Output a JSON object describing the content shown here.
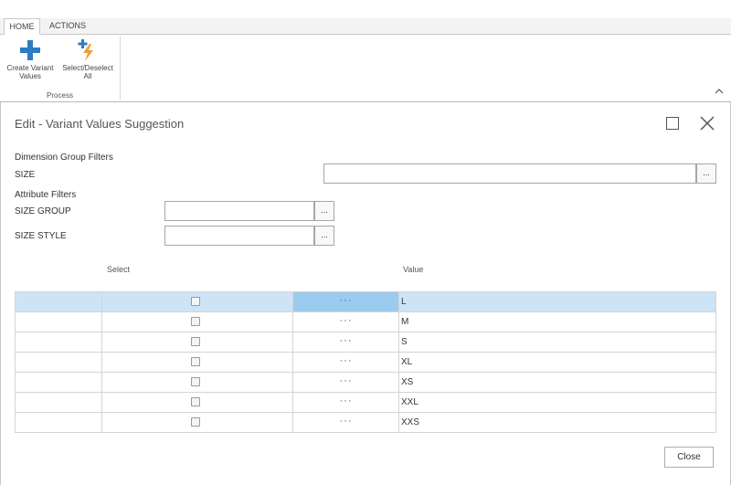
{
  "ribbon": {
    "tabs": [
      "HOME",
      "ACTIONS"
    ],
    "buttons": [
      {
        "label": "Create Variant Values",
        "icon": "plus-icon"
      },
      {
        "label": "Select/Deselect All",
        "icon": "select-deselect-icon"
      }
    ],
    "group_label": "Process"
  },
  "dialog": {
    "title": "Edit - Variant Values Suggestion",
    "dimension_section": "Dimension Group Filters",
    "size_label": "SIZE",
    "size_value": "",
    "attribute_section": "Attribute Filters",
    "size_group_label": "SIZE GROUP",
    "size_group_value": "",
    "size_style_label": "SIZE STYLE",
    "size_style_value": "",
    "lookup_label": "...",
    "columns": {
      "select": "Select",
      "value": "Value"
    },
    "rows": [
      {
        "value": "L",
        "checked": false,
        "selected": true
      },
      {
        "value": "M",
        "checked": false
      },
      {
        "value": "S",
        "checked": false
      },
      {
        "value": "XL",
        "checked": false
      },
      {
        "value": "XS",
        "checked": false
      },
      {
        "value": "XXL",
        "checked": false
      },
      {
        "value": "XXS",
        "checked": false
      }
    ],
    "row_menu": "···",
    "close_label": "Close"
  },
  "colors": {
    "selected_row": "#cde4f7",
    "selected_cell": "#9bcbee",
    "icon_blue": "#2e7cc4",
    "icon_orange": "#f0a030"
  }
}
